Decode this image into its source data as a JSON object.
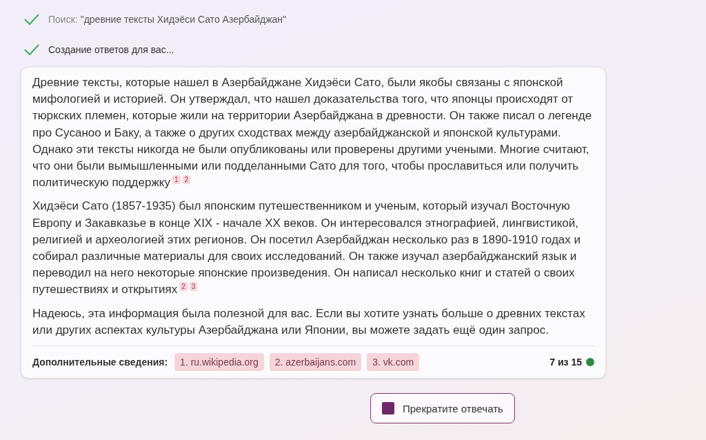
{
  "steps": [
    {
      "done": true,
      "label": "Поиск:",
      "query": "\"древние тексты Хидэёси Сато Азербайджан\""
    },
    {
      "done": true,
      "label": "Создание ответов для вас..."
    }
  ],
  "answer": {
    "paragraphs": [
      {
        "text": "Древние тексты, которые нашел в Азербайджане Хидэёси Сато, были якобы связаны с японской мифологией и историей. Он утверждал, что нашел доказательства того, что японцы происходят от тюркских племен, которые жили на территории Азербайджана в древности. Он также писал о легенде про Сусаноо и Баку, а также о других сходствах между азербайджанской и японской культурами. Однако эти тексты никогда не были опубликованы или проверены другими учеными. Многие считают, что они были вымышленными или подделанными Сато для того, чтобы прославиться или получить политическую поддержку",
        "citations": [
          "1",
          "2"
        ]
      },
      {
        "text": "Хидэёси Сато (1857-1935) был японским путешественником и ученым, который изучал Восточную Европу и Закавказье в конце XIX - начале XX веков. Он интересовался этнографией, лингвистикой, религией и археологией этих регионов. Он посетил Азербайджан несколько раз в 1890-1910 годах и собирал различные материалы для своих исследований. Он также изучал азербайджанский язык и переводил на него некоторые японские произведения. Он написал несколько книг и статей о своих путешествиях и открытиях",
        "citations": [
          "2",
          "3"
        ]
      },
      {
        "text": "Надеюсь, эта информация была полезной для вас. Если вы хотите узнать больше о древних текстах или других аспектах культуры Азербайджана или Японии, вы можете задать ещё один запрос."
      }
    ],
    "footer": {
      "label": "Дополнительные сведения:",
      "sources": [
        "1. ru.wikipedia.org",
        "2. azerbaijans.com",
        "3. vk.com"
      ],
      "count": "7 из 15"
    }
  },
  "stop_button": {
    "label": "Прекратите отвечать"
  }
}
